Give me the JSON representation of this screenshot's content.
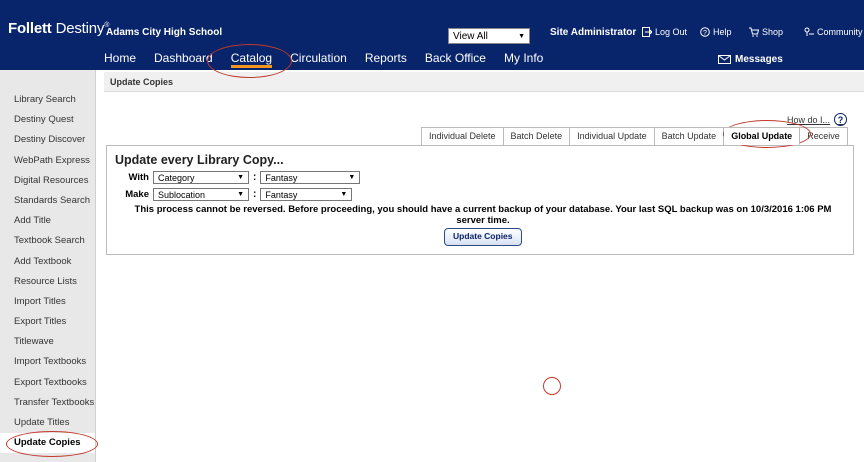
{
  "header": {
    "logo_brand": "Follett",
    "logo_product": "Destiny",
    "logo_reg": "®",
    "school": "Adams City High School",
    "site_select": "View All",
    "user": "Site Administrator",
    "logout": "Log Out",
    "help": "Help",
    "shop": "Shop",
    "community": "Community",
    "messages": "Messages"
  },
  "nav": {
    "items": [
      {
        "label": "Home"
      },
      {
        "label": "Dashboard"
      },
      {
        "label": "Catalog",
        "active": true
      },
      {
        "label": "Circulation"
      },
      {
        "label": "Reports"
      },
      {
        "label": "Back Office"
      },
      {
        "label": "My Info"
      }
    ]
  },
  "breadcrumb": "Update Copies",
  "sidebar": {
    "items": [
      {
        "label": "Library Search"
      },
      {
        "label": "Destiny Quest"
      },
      {
        "label": "Destiny Discover"
      },
      {
        "label": "WebPath Express"
      },
      {
        "label": "Digital Resources"
      },
      {
        "label": "Standards Search"
      },
      {
        "label": "Add Title"
      },
      {
        "label": "Textbook Search"
      },
      {
        "label": "Add Textbook"
      },
      {
        "label": "Resource Lists"
      },
      {
        "label": "Import Titles"
      },
      {
        "label": "Export Titles"
      },
      {
        "label": "Titlewave"
      },
      {
        "label": "Import Textbooks"
      },
      {
        "label": "Export Textbooks"
      },
      {
        "label": "Transfer Textbooks"
      },
      {
        "label": "Update Titles"
      },
      {
        "label": "Update Copies",
        "active": true
      }
    ]
  },
  "help_link": "How do I...",
  "help_icon": "?",
  "tabs": [
    {
      "label": "Individual Delete"
    },
    {
      "label": "Batch Delete"
    },
    {
      "label": "Individual Update"
    },
    {
      "label": "Batch Update"
    },
    {
      "label": "Global Update",
      "active": true
    },
    {
      "label": "Receive"
    }
  ],
  "panel": {
    "title": "Update every Library Copy...",
    "with_label": "With",
    "with_field": "Category",
    "with_value": "Fantasy",
    "make_label": "Make",
    "make_field": "Sublocation",
    "make_value": "Fantasy",
    "warning": "This process cannot be reversed. Before proceeding, you should have a current backup of your database. Your last SQL backup was on 10/3/2016 1:06 PM server time.",
    "button": "Update Copies"
  },
  "colors": {
    "header_bg": "#08246b",
    "nav_active_underline": "#f7941d",
    "annotation": "#c0392b"
  }
}
